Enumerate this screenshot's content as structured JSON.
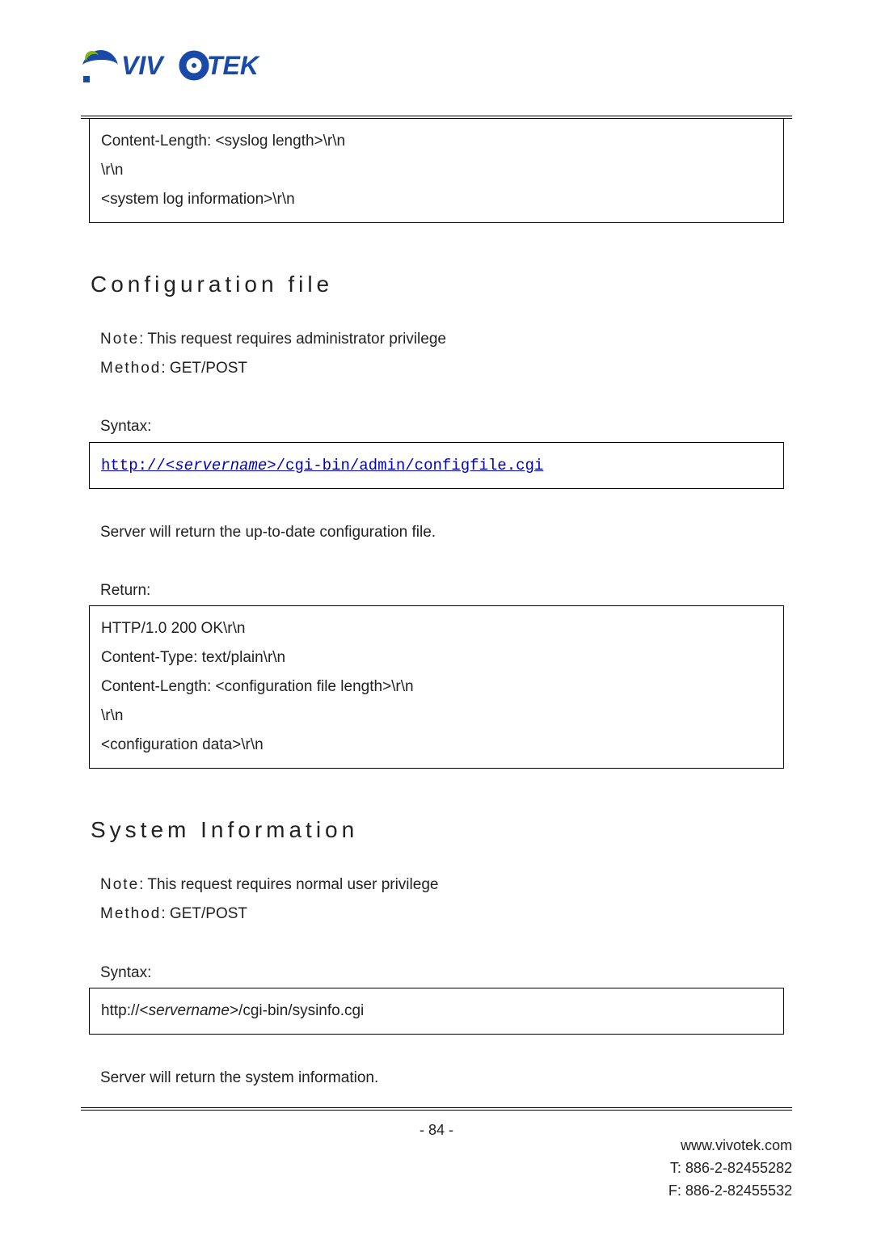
{
  "brand": {
    "name": "VIVOTEK"
  },
  "box_top": {
    "l1": "Content-Length: <syslog length>\\r\\n",
    "l2": "\\r\\n",
    "l3": "<system log information>\\r\\n"
  },
  "config": {
    "heading": "Configuration file",
    "note_label": "Note",
    "note_text": ": This request requires administrator privilege",
    "method_label": "Method",
    "method_text": ": GET/POST",
    "syntax_label": "Syntax:",
    "url_prefix": "http://<",
    "url_server": "servername",
    "url_suffix": ">/cgi-bin/admin/configfile.cgi",
    "desc": "Server will return the up-to-date configuration file.",
    "return_label": "Return:",
    "ret_l1": "HTTP/1.0 200 OK\\r\\n",
    "ret_l2": "Content-Type: text/plain\\r\\n",
    "ret_l3": "Content-Length: <configuration file length>\\r\\n",
    "ret_l4": "\\r\\n",
    "ret_l5": "<configuration data>\\r\\n"
  },
  "sysinfo": {
    "heading": "System Information",
    "note_label": "Note",
    "note_text": ": This request requires normal user privilege",
    "method_label": "Method",
    "method_text": ": GET/POST",
    "syntax_label": "Syntax:",
    "url_prefix": "http://<",
    "url_server": "servername",
    "url_suffix": ">/cgi-bin/sysinfo.cgi",
    "desc": "Server will return the system information."
  },
  "footer": {
    "page_num": "- 84 -",
    "site": "www.vivotek.com",
    "tel": "T: 886-2-82455282",
    "fax": "F: 886-2-82455532"
  }
}
